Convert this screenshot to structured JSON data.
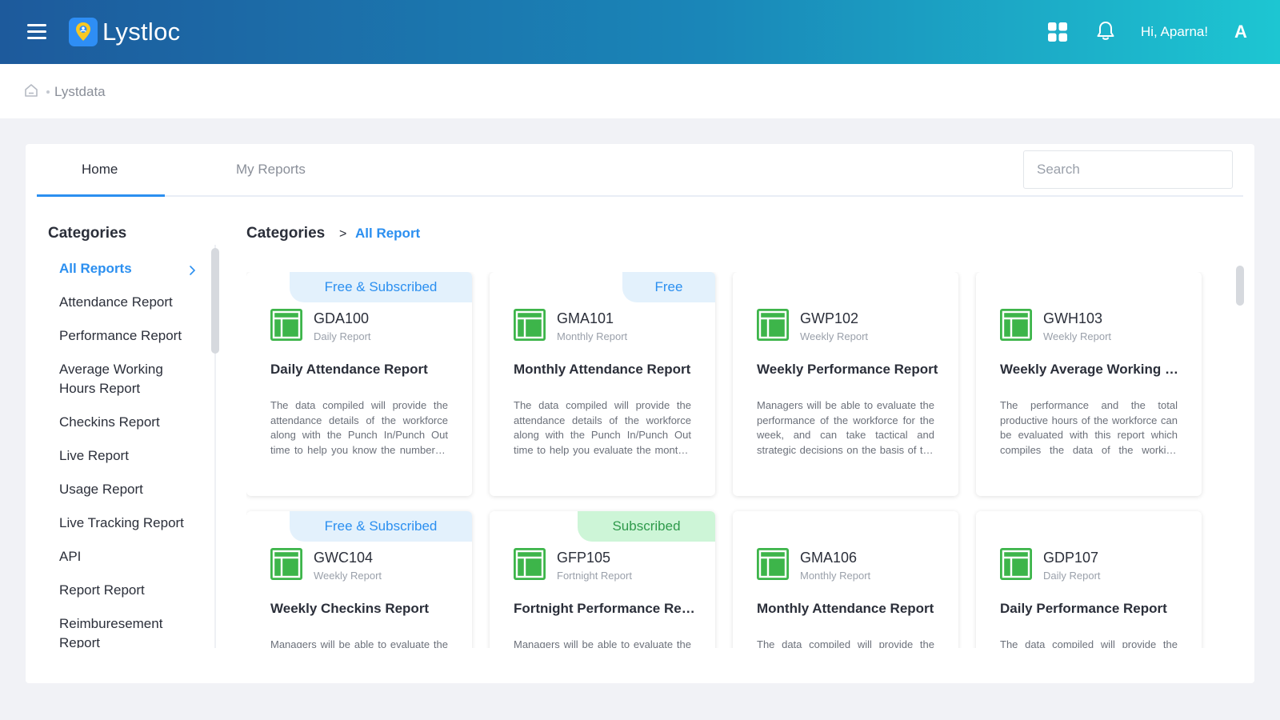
{
  "header": {
    "app_name": "Lystloc",
    "greeting": "Hi, Aparna!",
    "avatar_initial": "A"
  },
  "breadcrumb": {
    "current": "Lystdata"
  },
  "tabs": {
    "home": "Home",
    "my_reports": "My Reports"
  },
  "search": {
    "placeholder": "Search",
    "value": ""
  },
  "sidebar": {
    "title": "Categories",
    "items": [
      {
        "label": "All Reports",
        "active": true
      },
      {
        "label": "Attendance Report"
      },
      {
        "label": "Performance Report"
      },
      {
        "label": "Average Working Hours Report"
      },
      {
        "label": "Checkins Report"
      },
      {
        "label": "Live Report"
      },
      {
        "label": "Usage Report"
      },
      {
        "label": "Live Tracking Report"
      },
      {
        "label": "API"
      },
      {
        "label": "Report Report"
      },
      {
        "label": "Reimburesement Report"
      }
    ]
  },
  "content": {
    "breadcrumb_root": "Categories",
    "breadcrumb_sep": ">",
    "breadcrumb_current": "All Report",
    "reports": [
      {
        "badge": "Free & Subscribed",
        "badge_type": "both",
        "code": "GDA100",
        "period": "Daily Report",
        "name": "Daily Attendance Report",
        "description": "The data compiled will provide the attendance details of the workforce along with the Punch In/Punch Out time to help you know the number of hours worked."
      },
      {
        "badge": "Free",
        "badge_type": "free",
        "code": "GMA101",
        "period": "Monthly Report",
        "name": "Monthly Attendance Report",
        "description": "The data compiled will provide the attendance details of the workforce along with the Punch In/Punch Out time to help you evaluate the monthly attendance."
      },
      {
        "badge": "",
        "badge_type": "none",
        "code": "GWP102",
        "period": "Weekly Report",
        "name": "Weekly Performance Report",
        "description": "Managers will be able to evaluate the performance of the workforce for the week, and can take tactical and strategic decisions on the basis of the data."
      },
      {
        "badge": "",
        "badge_type": "none",
        "code": "GWH103",
        "period": "Weekly Report",
        "name": "Weekly Average Working Hours Report",
        "description": "The performance and the total productive hours of the workforce can be evaluated with this report which compiles the data of the working hours."
      },
      {
        "badge": "Free & Subscribed",
        "badge_type": "both",
        "code": "GWC104",
        "period": "Weekly Report",
        "name": "Weekly Checkins Report",
        "description": "Managers will be able to evaluate the checkins of the workforce for the week."
      },
      {
        "badge": "Subscribed",
        "badge_type": "sub",
        "code": "GFP105",
        "period": "Fortnight Report",
        "name": "Fortnight Performance Report",
        "description": "Managers will be able to evaluate the performance of the workforce for the fortnight."
      },
      {
        "badge": "",
        "badge_type": "none",
        "code": "GMA106",
        "period": "Monthly Report",
        "name": "Monthly Attendance Report",
        "description": "The data compiled will provide the attendance details of the workforce for the month."
      },
      {
        "badge": "",
        "badge_type": "none",
        "code": "GDP107",
        "period": "Daily Report",
        "name": "Daily Performance Report",
        "description": "The data compiled will provide the performance details of the workforce for the day."
      }
    ]
  },
  "colors": {
    "accent": "#2b8ff0",
    "header_start": "#1d5a9c",
    "header_end": "#1dc6d2",
    "sheet_icon": "#3db54a",
    "badge_subscribed": "#cdf5d7"
  }
}
